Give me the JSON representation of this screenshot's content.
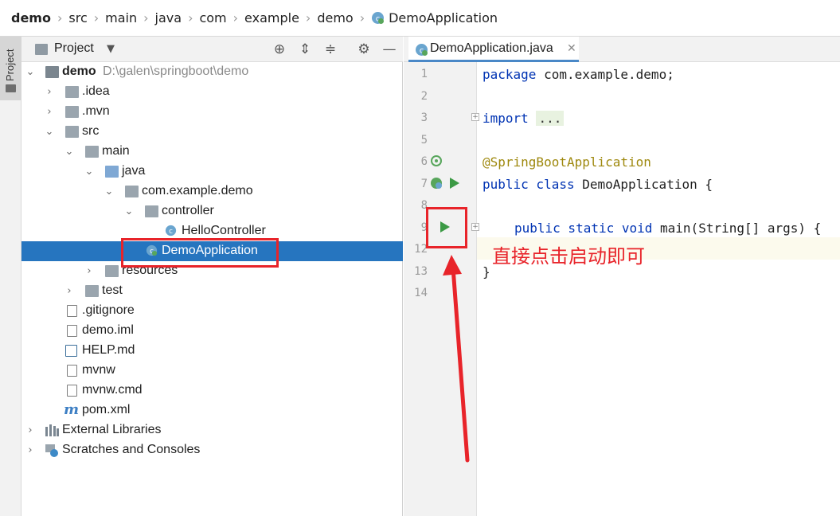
{
  "breadcrumb": [
    "demo",
    "src",
    "main",
    "java",
    "com",
    "example",
    "demo",
    "DemoApplication"
  ],
  "stripe": {
    "project_label": "Project"
  },
  "project_panel": {
    "title": "Project",
    "tree": [
      {
        "label": "demo",
        "path": "D:\\galen\\springboot\\demo"
      },
      {
        "label": ".idea"
      },
      {
        "label": ".mvn"
      },
      {
        "label": "src"
      },
      {
        "label": "main"
      },
      {
        "label": "java"
      },
      {
        "label": "com.example.demo"
      },
      {
        "label": "controller"
      },
      {
        "label": "HelloController"
      },
      {
        "label": "DemoApplication"
      },
      {
        "label": "resources"
      },
      {
        "label": "test"
      },
      {
        "label": ".gitignore"
      },
      {
        "label": "demo.iml"
      },
      {
        "label": "HELP.md"
      },
      {
        "label": "mvnw"
      },
      {
        "label": "mvnw.cmd"
      },
      {
        "label": "pom.xml"
      },
      {
        "label": "External Libraries"
      },
      {
        "label": "Scratches and Consoles"
      }
    ]
  },
  "editor": {
    "tab_label": "DemoApplication.java",
    "line_numbers": [
      "1",
      "2",
      "3",
      "5",
      "6",
      "7",
      "8",
      "9",
      "12",
      "13",
      "14"
    ],
    "code": {
      "l1_kw": "package",
      "l1_rest": " com.example.demo;",
      "l3_kw": "import",
      "l3_dots": "...",
      "l6": "@SpringBootApplication",
      "l7_kw": "public class",
      "l7_rest": " DemoApplication {",
      "l9_kw": "public static void",
      "l9_rest": " main(String[] args) {",
      "l13": "}"
    }
  },
  "annotation": {
    "text": "直接点击启动即可"
  },
  "colors": {
    "selection": "#2675bf",
    "keyword": "#0033b3",
    "annotation": "#9e880d",
    "highlight_red": "#e8242a",
    "run_green": "#3c9a45"
  }
}
